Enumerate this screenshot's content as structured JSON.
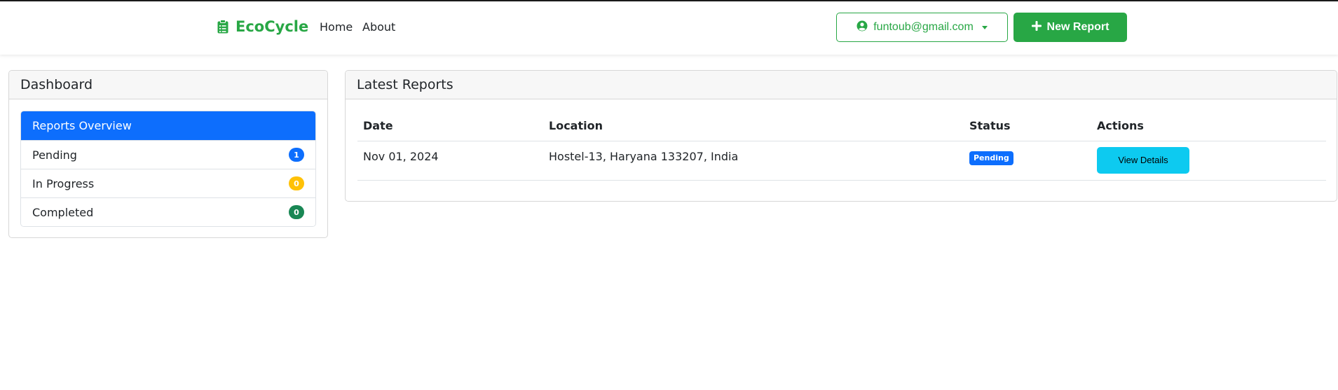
{
  "navbar": {
    "brand": "EcoCycle",
    "links": [
      {
        "label": "Home"
      },
      {
        "label": "About"
      }
    ],
    "user_email": "funtoub@gmail.com",
    "new_report_label": "New Report"
  },
  "dashboard": {
    "title": "Dashboard",
    "items": [
      {
        "label": "Reports Overview",
        "active": true
      },
      {
        "label": "Pending",
        "count": "1",
        "badge_color": "#0d6efd"
      },
      {
        "label": "In Progress",
        "count": "0",
        "badge_color": "#ffc107"
      },
      {
        "label": "Completed",
        "count": "0",
        "badge_color": "#198754"
      }
    ]
  },
  "reports": {
    "title": "Latest Reports",
    "columns": [
      "Date",
      "Location",
      "Status",
      "Actions"
    ],
    "rows": [
      {
        "date": "Nov 01, 2024",
        "location": "Hostel-13, Haryana 133207, India",
        "status": "Pending",
        "status_color": "#0d6efd",
        "action_label": "View Details"
      }
    ]
  },
  "colors": {
    "brand": "#28a745",
    "primary": "#0d6efd",
    "info": "#0dcaf0"
  },
  "icons": {
    "brand": "clipboard-list-icon",
    "user": "user-circle-icon",
    "new_report": "plus-icon",
    "dropdown": "caret-down-icon"
  }
}
